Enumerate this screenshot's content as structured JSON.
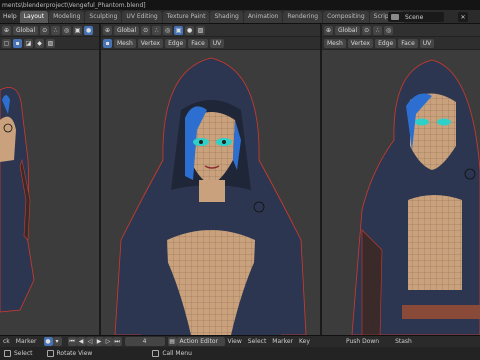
{
  "titlebar": {
    "title": "ments\\blenderproject\\Vengeful_Phantom.blend]"
  },
  "menubar": {
    "help": "Help",
    "tabs": [
      "Layout",
      "Modeling",
      "Sculpting",
      "UV Editing",
      "Texture Paint",
      "Shading",
      "Animation",
      "Rendering",
      "Compositing",
      "Scripting"
    ],
    "active_tab": "Layout",
    "add_tab": "+",
    "scene_label": "Scene",
    "scene_close": "✕"
  },
  "viewports": [
    {
      "name": "left",
      "orientation": "Global",
      "menus": []
    },
    {
      "name": "center",
      "orientation": "Global",
      "menus": [
        "Mesh",
        "Vertex",
        "Edge",
        "Face",
        "UV"
      ]
    },
    {
      "name": "right",
      "orientation": "Global",
      "menus": [
        "Mesh",
        "Vertex",
        "Edge",
        "Face",
        "UV"
      ]
    }
  ],
  "viewport_left_menus": [
    "Mesh",
    "Vertex",
    "Edge",
    "Face",
    "UV"
  ],
  "timeline": {
    "items": [
      "ck",
      "Marker"
    ],
    "frame": "4",
    "editor_type": "Action Editor",
    "menus": [
      "View",
      "Select",
      "Marker",
      "Key"
    ],
    "actions": [
      "Push Down",
      "Stash"
    ]
  },
  "statusbar": {
    "items": [
      "Select",
      "Rotate View",
      "Call Menu"
    ]
  },
  "colors": {
    "accent": "#4772b3",
    "skin": "#c9a27d",
    "hood": "#2d3650",
    "hair": "#2d6fd0",
    "eyeshadow": "#2fd0c8",
    "seam": "#d23a2a"
  }
}
